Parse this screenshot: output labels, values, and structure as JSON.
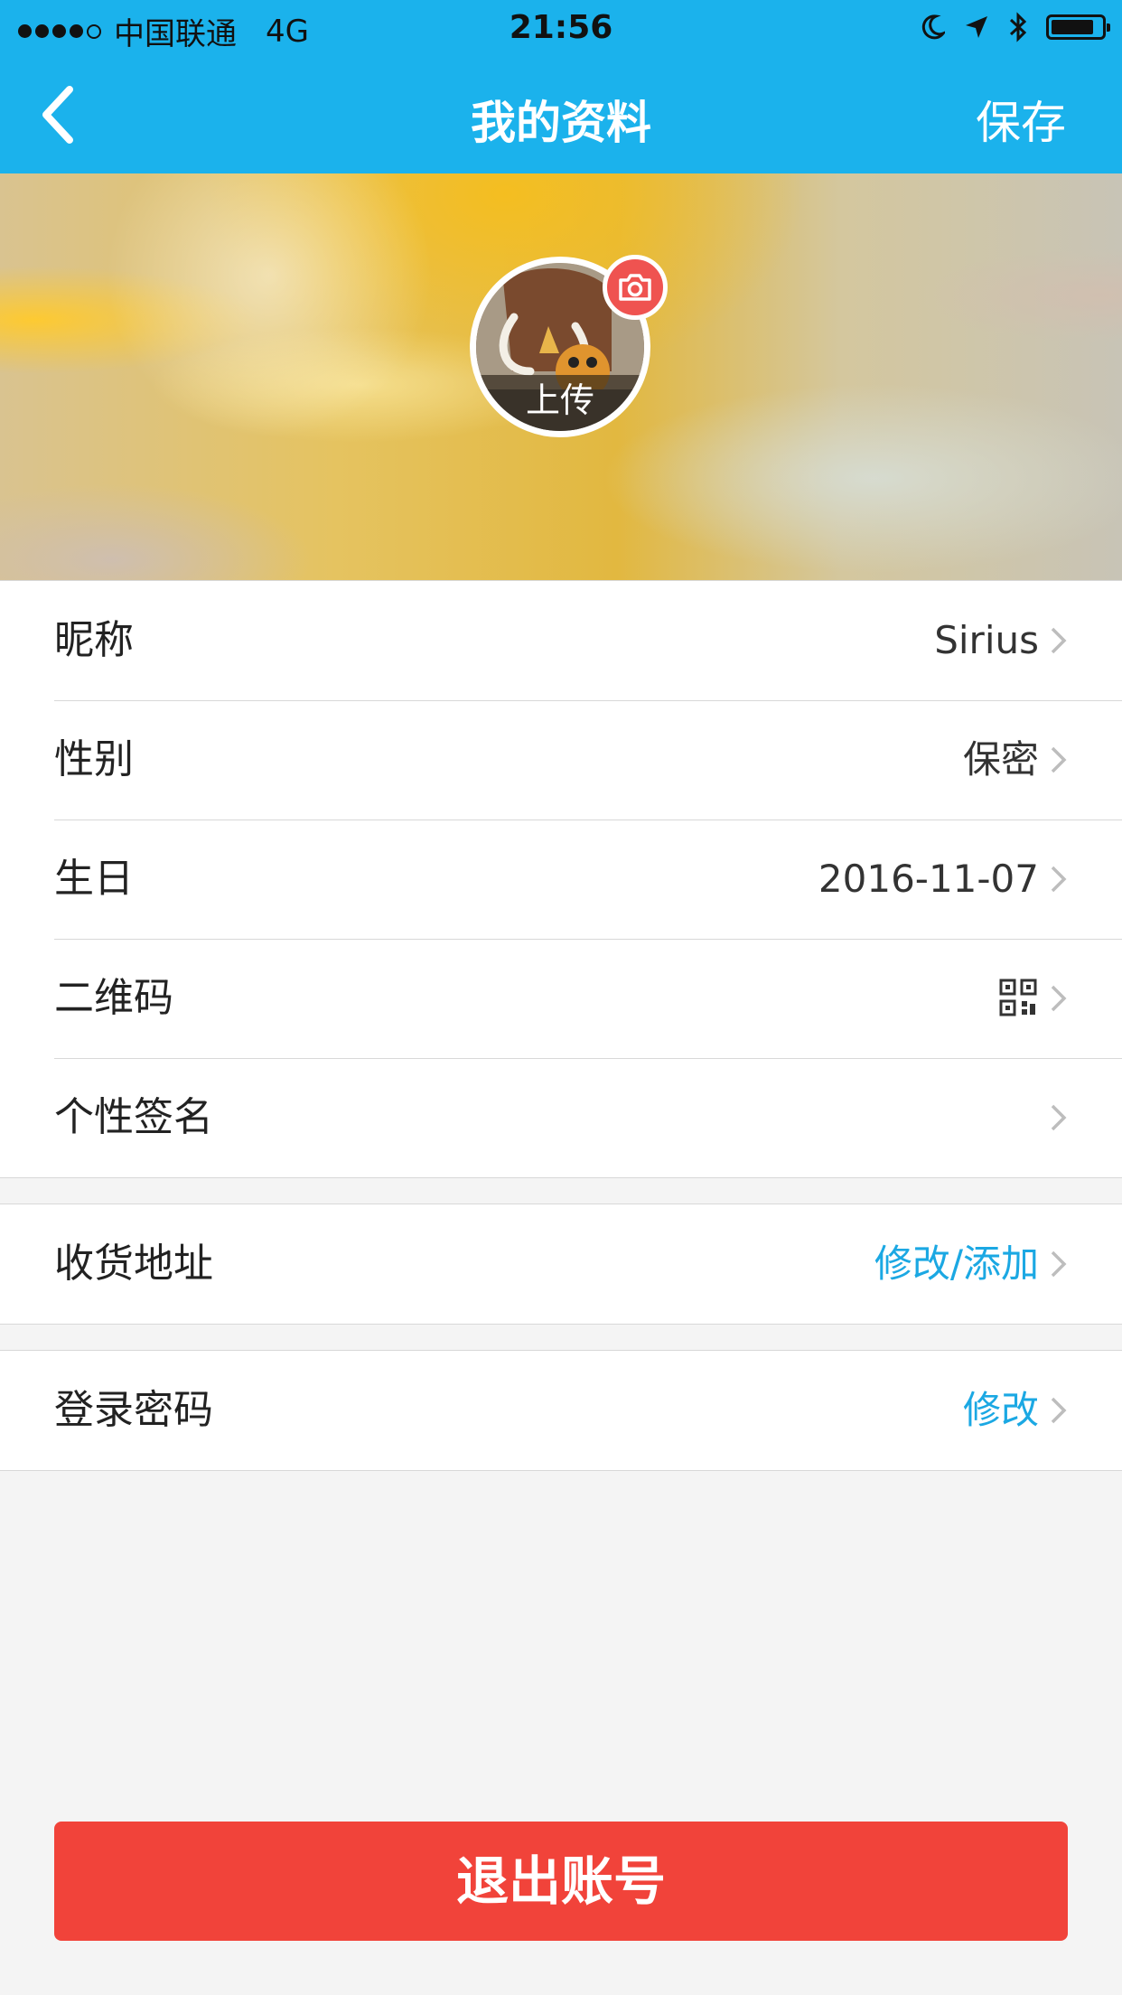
{
  "status_bar": {
    "carrier": "中国联通",
    "network": "4G",
    "time": "21:56",
    "battery_level": 0.85
  },
  "nav": {
    "title": "我的资料",
    "save_label": "保存"
  },
  "avatar": {
    "upload_label": "上传"
  },
  "profile_rows": [
    {
      "label": "昵称",
      "value": "Sirius"
    },
    {
      "label": "性别",
      "value": "保密"
    },
    {
      "label": "生日",
      "value": "2016-11-07"
    },
    {
      "label": "二维码",
      "value_icon": "qr-code-icon"
    },
    {
      "label": "个性签名",
      "value": ""
    }
  ],
  "address_row": {
    "label": "收货地址",
    "value": "修改/添加"
  },
  "password_row": {
    "label": "登录密码",
    "value": "修改"
  },
  "logout_label": "退出账号",
  "colors": {
    "brand": "#1bb2ec",
    "link": "#1ba8e3",
    "danger": "#f1433a",
    "camera_badge": "#ef5350",
    "background": "#f4f4f4"
  }
}
